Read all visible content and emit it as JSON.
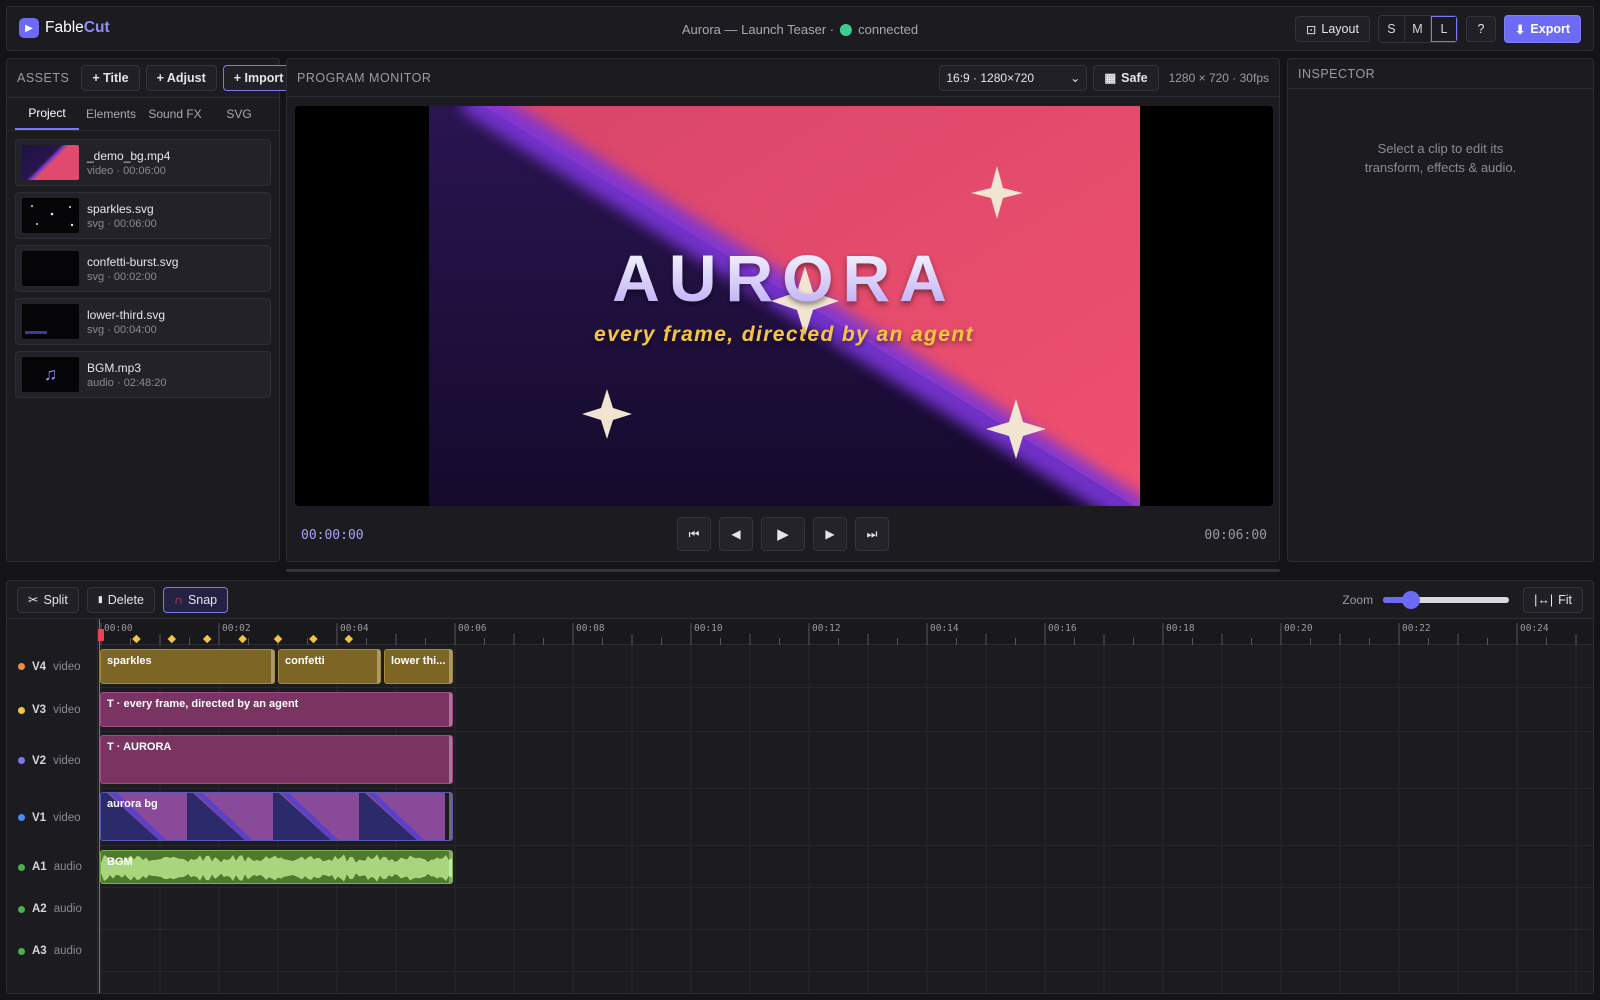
{
  "app": {
    "name_a": "Fable",
    "name_b": "Cut",
    "logo_glyph": "▶"
  },
  "project": {
    "title": "Aurora — Launch Teaser ·",
    "status": "connected",
    "status_color": "#3ecf8e"
  },
  "header": {
    "layout_label": "Layout",
    "layout_icon": "⊡",
    "sizes": [
      "S",
      "M",
      "L"
    ],
    "active_size": "L",
    "help_label": "?",
    "export_label": "Export",
    "export_icon": "⬇"
  },
  "assets": {
    "title": "ASSETS",
    "buttons": {
      "title": "+ Title",
      "adjust": "+ Adjust",
      "import": "+ Import"
    },
    "tabs": [
      "Project",
      "Elements",
      "Sound FX",
      "SVG"
    ],
    "active_tab": "Project",
    "items": [
      {
        "name": "_demo_bg.mp4",
        "meta": "video · 00:06:00"
      },
      {
        "name": "sparkles.svg",
        "meta": "svg · 00:06:00"
      },
      {
        "name": "confetti-burst.svg",
        "meta": "svg · 00:02:00"
      },
      {
        "name": "lower-third.svg",
        "meta": "svg · 00:04:00"
      },
      {
        "name": "BGM.mp3",
        "meta": "audio · 02:48:20",
        "icon": "♫"
      }
    ]
  },
  "monitor": {
    "title": "PROGRAM MONITOR",
    "aspect_select": "16:9 · 1280×720",
    "safe_label": "Safe",
    "safe_icon": "▦",
    "resolution": "1280 × 720 · 30fps",
    "frame": {
      "headline": "AURORA",
      "tagline": "every frame, directed by an agent"
    },
    "timecode_current": "00:00:00",
    "timecode_duration": "00:06:00",
    "transport": {
      "start": "⏮",
      "prev": "◀",
      "play": "▶",
      "next": "▶",
      "end": "⏭"
    }
  },
  "inspector": {
    "title": "INSPECTOR",
    "empty_line1": "Select a clip to edit its",
    "empty_line2": "transform, effects & audio."
  },
  "timeline": {
    "tools": {
      "split": "Split",
      "split_icon": "✂",
      "delete": "Delete",
      "delete_icon": "▮",
      "snap": "Snap",
      "snap_icon": "∩"
    },
    "zoom_label": "Zoom",
    "zoom_level": 0.22,
    "fit_label": "Fit",
    "fit_icon": "|↔|",
    "ruler_labels": [
      "00:00",
      "00:02",
      "00:04",
      "00:06",
      "00:08",
      "00:10",
      "00:12",
      "00:14",
      "00:16",
      "00:18",
      "00:20",
      "00:22",
      "00:24"
    ],
    "keyframe_color": "#f5c542",
    "tracks": [
      {
        "id": "V4",
        "kind": "video",
        "color": "#f08a4b"
      },
      {
        "id": "V3",
        "kind": "video",
        "color": "#f5c542"
      },
      {
        "id": "V2",
        "kind": "video",
        "color": "#7b78f0"
      },
      {
        "id": "V1",
        "kind": "video",
        "color": "#4c8cf5"
      },
      {
        "id": "A1",
        "kind": "audio",
        "color": "#4caf50"
      },
      {
        "id": "A2",
        "kind": "audio",
        "color": "#4caf50"
      },
      {
        "id": "A3",
        "kind": "audio",
        "color": "#4caf50"
      }
    ],
    "clips": {
      "sparkles": "sparkles",
      "confetti": "confetti",
      "lower_third": "lower thi...",
      "tagline": "T · every frame, directed by an agent",
      "headline": "T · AURORA",
      "aurora_bg": "aurora bg",
      "bgm": "BGM"
    }
  }
}
